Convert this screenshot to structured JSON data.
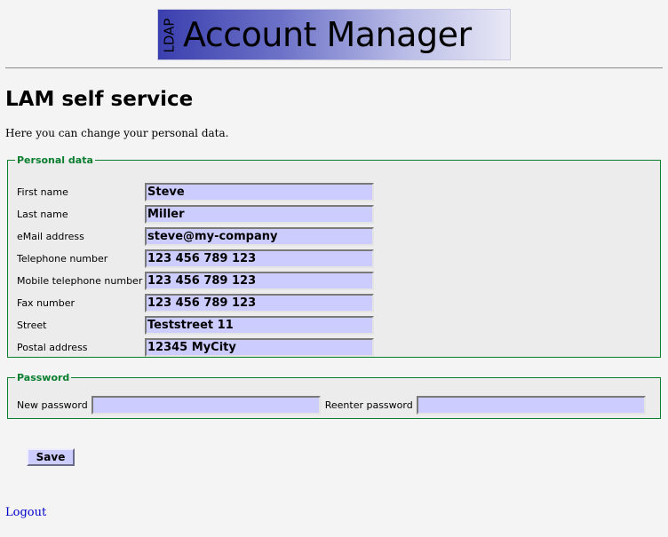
{
  "logo": {
    "side_text": "LDAP",
    "main_text": "Account Manager"
  },
  "page_title": "LAM self service",
  "intro_text": "Here you can change your personal data.",
  "personal": {
    "legend": "Personal data",
    "fields": [
      {
        "label": "First name",
        "value": "Steve"
      },
      {
        "label": "Last name",
        "value": "Miller"
      },
      {
        "label": "eMail address",
        "value": "steve@my-company"
      },
      {
        "label": "Telephone number",
        "value": "123 456 789 123"
      },
      {
        "label": "Mobile telephone number",
        "value": "123 456 789 123"
      },
      {
        "label": "Fax number",
        "value": "123 456 789 123"
      },
      {
        "label": "Street",
        "value": "Teststreet 11"
      },
      {
        "label": "Postal address",
        "value": "12345 MyCity"
      }
    ]
  },
  "password": {
    "legend": "Password",
    "new_label": "New password",
    "new_value": "",
    "reenter_label": "Reenter password",
    "reenter_value": ""
  },
  "save_label": "Save",
  "logout_label": "Logout",
  "colors": {
    "input_bg": "#ccccff",
    "legend": "#0a7f30",
    "link": "#0000cc"
  }
}
